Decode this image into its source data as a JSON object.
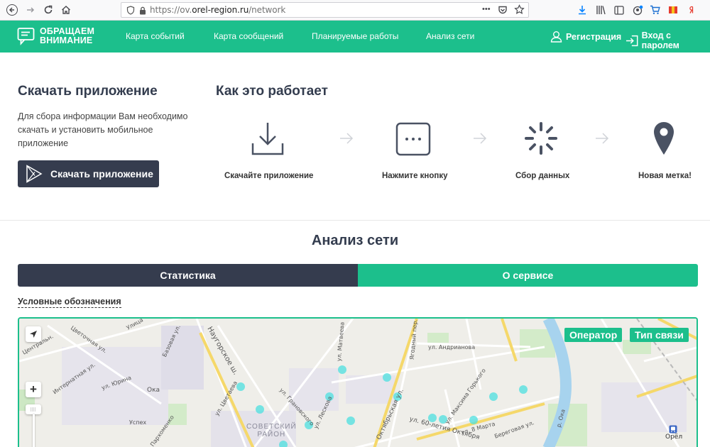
{
  "browser": {
    "url_prefix": "https://ov.",
    "url_domain": "orel-region.ru",
    "url_path": "/network",
    "dots": "•••"
  },
  "header": {
    "logo_line1": "ОБРАЩАЕМ",
    "logo_line2": "ВНИМАНИЕ",
    "menu": [
      "Карта событий",
      "Карта сообщений",
      "Планируемые работы",
      "Анализ сети"
    ],
    "register_label": "Регистрация",
    "login_label": "Вход с паролем"
  },
  "download": {
    "title": "Скачать приложение",
    "text": "Для сбора информации Вам необходимо скачать и установить мобильное приложение",
    "button_label": "Скачать приложение"
  },
  "how": {
    "title": "Как это работает",
    "steps": [
      {
        "label": "Скачайте приложение",
        "icon": "download-icon"
      },
      {
        "label": "Нажмите кнопку",
        "icon": "dots-button-icon"
      },
      {
        "label": "Сбор данных",
        "icon": "loading-spinner-icon"
      },
      {
        "label": "Новая метка!",
        "icon": "map-pin-icon"
      }
    ]
  },
  "analysis": {
    "title": "Анализ сети",
    "tabs": [
      "Статистика",
      "О сервисе"
    ],
    "legend_link": "Условные обозначения"
  },
  "map": {
    "operator_label": "Оператор",
    "connection_label": "Тип связи",
    "zoom_in": "+",
    "district_line1": "СОВЕТСКИЙ",
    "district_line2": "РАЙОН",
    "streets": [
      "Цветочная ул.",
      "Центральн.",
      "Улица",
      "Интернатная ул.",
      "ул. Юрина",
      "Ока",
      "Успех",
      "ул. Пархоменко",
      "Базовая ул.",
      "Наугорское ш.",
      "ул. Цветаева",
      "ул. Грановского",
      "ул. Лескова",
      "ул. Матвеева",
      "Ягодный пер.",
      "ул. Андрианова",
      "Октябрьская ул.",
      "ул. 60-летия Октября",
      "ул. Максима Горького",
      "ул. 8 Марта",
      "Береговая ул.",
      "р. Ока",
      "Орёл"
    ],
    "colors": {
      "accent": "#1cbf8c",
      "dark": "#353c4e",
      "point": "#4de0e0"
    }
  }
}
